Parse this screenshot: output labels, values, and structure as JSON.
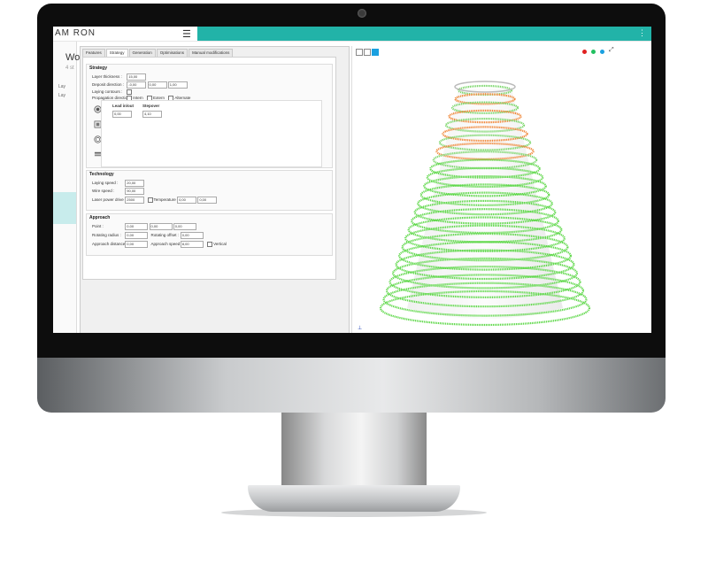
{
  "app": {
    "brand": "AM RON",
    "menu_icon": "hamburger-icon",
    "more_icon": "more-vertical-icon"
  },
  "sidebar": {
    "title": "Wo",
    "subtitle": "4 st",
    "items": [
      {
        "label": "Lay"
      },
      {
        "label": "Lay"
      }
    ]
  },
  "tabs": [
    "Features",
    "Strategy",
    "Generation",
    "Optimisations",
    "Manual modifications"
  ],
  "strategy": {
    "title": "Strategy",
    "layer_thickness": {
      "label": "Layer thickness :",
      "value": "15,00"
    },
    "deposit_direction": {
      "label": "Deposit direction :",
      "values": [
        "-0,00",
        "0,00",
        "1,00"
      ]
    },
    "laying_contours": {
      "label": "Laying contours :"
    },
    "propagation_direction": {
      "label": "Propagation direction :",
      "options": [
        "Intern",
        "Extern",
        "Alternate"
      ]
    },
    "lead_in_out": {
      "label": "Lead in/out",
      "value": "0,00"
    },
    "stepover": {
      "label": "Stepover",
      "value": "4,10"
    }
  },
  "technology": {
    "title": "Technology",
    "laying_speed": {
      "label": "Laying speed :",
      "value": "20,00"
    },
    "wire_speed": {
      "label": "Wire speed :",
      "value": "90,00"
    },
    "laser_power_drive": {
      "label": "Laser power drive :",
      "value": "2500"
    },
    "temperature": {
      "label": "Temperature",
      "values": [
        "0,00",
        "0,00"
      ]
    }
  },
  "approach": {
    "title": "Approach",
    "point": {
      "label": "Point :",
      "values": [
        "0,00",
        "0,00",
        "0,00"
      ]
    },
    "rotating_radius": {
      "label": "Rotating radius :",
      "value": "0,00"
    },
    "rotating_offset": {
      "label": "Rotating offset :",
      "value": "0,00"
    },
    "approach_distance": {
      "label": "Approach distance :",
      "value": "0,00"
    },
    "approach_speed": {
      "label": "Approach speed :",
      "value": "8,00"
    },
    "vertical": {
      "label": "Vertical"
    }
  },
  "viewport": {
    "status_colors": [
      "#e02020",
      "#22c060",
      "#1aa0e0"
    ],
    "expand_icon": "expand-icon"
  }
}
